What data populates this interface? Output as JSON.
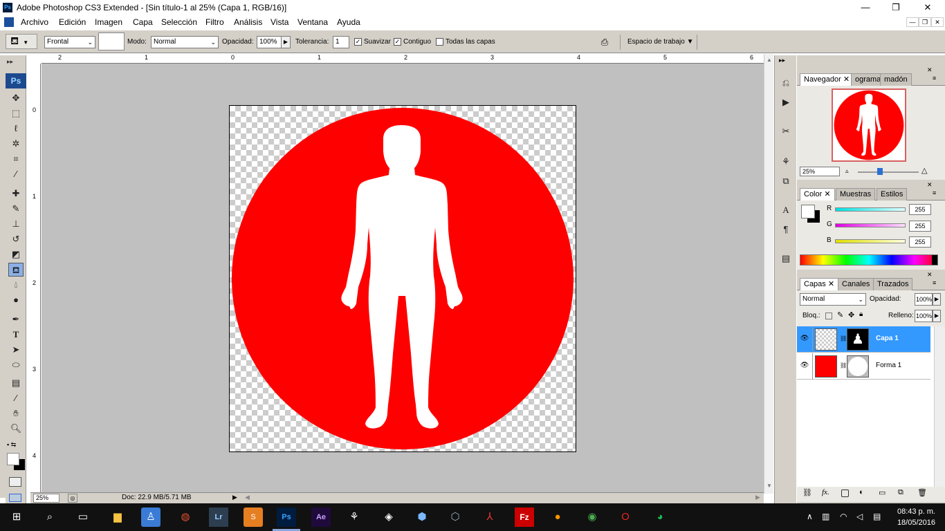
{
  "window": {
    "title": "Adobe Photoshop CS3 Extended - [Sin título-1 al 25% (Capa 1, RGB/16)]",
    "icon_text": "Ps",
    "controls": [
      "—",
      "❐",
      "✕"
    ]
  },
  "menu": {
    "items": [
      "Archivo",
      "Edición",
      "Imagen",
      "Capa",
      "Selección",
      "Filtro",
      "Análisis",
      "Vista",
      "Ventana",
      "Ayuda"
    ],
    "doc_controls": [
      "—",
      "❐",
      "✕"
    ]
  },
  "options": {
    "fill_source": "Frontal",
    "mode_label": "Modo:",
    "mode_value": "Normal",
    "opacity_label": "Opacidad:",
    "opacity_value": "100%",
    "tolerance_label": "Tolerancia:",
    "tolerance_value": "1",
    "antialias_label": "Suavizar",
    "antialias_checked": true,
    "contiguous_label": "Contiguo",
    "contiguous_checked": true,
    "all_layers_label": "Todas las capas",
    "all_layers_checked": false,
    "workspace_label": "Espacio de trabajo"
  },
  "toolbox": {
    "logo": "Ps",
    "tools": [
      "move-icon",
      "marquee-icon",
      "lasso-icon",
      "magic-wand-icon",
      "crop-icon",
      "slice-icon",
      "healing-icon",
      "brush-icon",
      "stamp-icon",
      "history-brush-icon",
      "eraser-icon",
      "paint-bucket-icon",
      "blur-icon",
      "dodge-icon",
      "pen-icon",
      "type-icon",
      "path-select-icon",
      "ellipse-icon",
      "notes-icon",
      "eyedropper-icon",
      "hand-icon",
      "zoom-icon"
    ],
    "active_tool": "paint-bucket-icon"
  },
  "rulers": {
    "top_labels": [
      "2",
      "1",
      "0",
      "1",
      "2",
      "3",
      "4",
      "5",
      "6"
    ],
    "left_labels": [
      "0",
      "1",
      "2",
      "3",
      "4"
    ]
  },
  "document": {
    "shape_color": "#ff0000",
    "figure_color": "#ffffff"
  },
  "status": {
    "zoom": "25%",
    "doc_info": "Doc: 22.9 MB/5.71 MB"
  },
  "navigator": {
    "tabs": [
      "Navegador",
      "ograma",
      "madón"
    ],
    "zoom": "25%"
  },
  "color_panel": {
    "tabs": [
      "Color",
      "Muestras",
      "Estilos"
    ],
    "channels": [
      {
        "label": "R",
        "value": "255",
        "color": "#00e0e0"
      },
      {
        "label": "G",
        "value": "255",
        "color": "#e000e0"
      },
      {
        "label": "B",
        "value": "255",
        "color": "#e0e000"
      }
    ]
  },
  "layers_panel": {
    "tabs": [
      "Capas",
      "Canales",
      "Trazados"
    ],
    "blend_mode": "Normal",
    "opacity_label": "Opacidad:",
    "opacity_value": "100%",
    "lock_label": "Bloq.:",
    "fill_label": "Relleno:",
    "fill_value": "100%",
    "layers": [
      {
        "name": "Capa 1",
        "selected": true
      },
      {
        "name": "Forma 1",
        "selected": false
      }
    ],
    "footer_icons": [
      "link-icon",
      "fx-icon",
      "mask-icon",
      "adjustment-icon",
      "group-icon",
      "new-layer-icon",
      "trash-icon"
    ]
  },
  "taskbar": {
    "time": "08:43 p. m.",
    "date": "18/05/2016",
    "apps": [
      "file-explorer-icon",
      "app-icon",
      "app-icon",
      "lightroom-icon",
      "app-icon",
      "photoshop-icon",
      "after-effects-icon",
      "app-icon",
      "unity-icon",
      "app-icon",
      "virtualbox-icon",
      "acrobat-icon",
      "filezilla-icon",
      "firefox-icon",
      "chrome-icon",
      "opera-icon",
      "spotify-icon"
    ]
  },
  "colors": {
    "accent": "#3399ff",
    "panel_bg": "#d4d0c8",
    "canvas_bg": "#c0c0c0"
  }
}
